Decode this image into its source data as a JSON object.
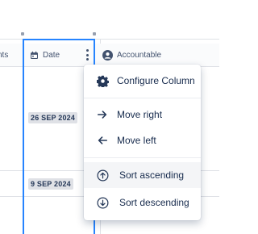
{
  "table": {
    "columns": [
      {
        "id": "ents",
        "label": "nts",
        "icon": "none"
      },
      {
        "id": "date",
        "label": "Date",
        "icon": "calendar-icon"
      },
      {
        "id": "accountable",
        "label": "Accountable",
        "icon": "user-avatar-icon"
      }
    ],
    "rows": [
      {
        "date": "26 SEP 2024"
      },
      {
        "date": "9 SEP 2024"
      }
    ]
  },
  "column_menu": {
    "items": [
      {
        "label": "Configure Column",
        "icon": "gear-icon"
      },
      {
        "label": "Move right",
        "icon": "arrow-right-icon"
      },
      {
        "label": "Move left",
        "icon": "arrow-left-icon"
      },
      {
        "label": "Sort ascending",
        "icon": "arrow-up-circle-icon"
      },
      {
        "label": "Sort descending",
        "icon": "arrow-down-circle-icon"
      }
    ]
  },
  "colors": {
    "selected_column_border": "#2684ff",
    "date_pill_bg": "#dfe1e6",
    "menu_hover_bg": "#f4f5f7"
  }
}
